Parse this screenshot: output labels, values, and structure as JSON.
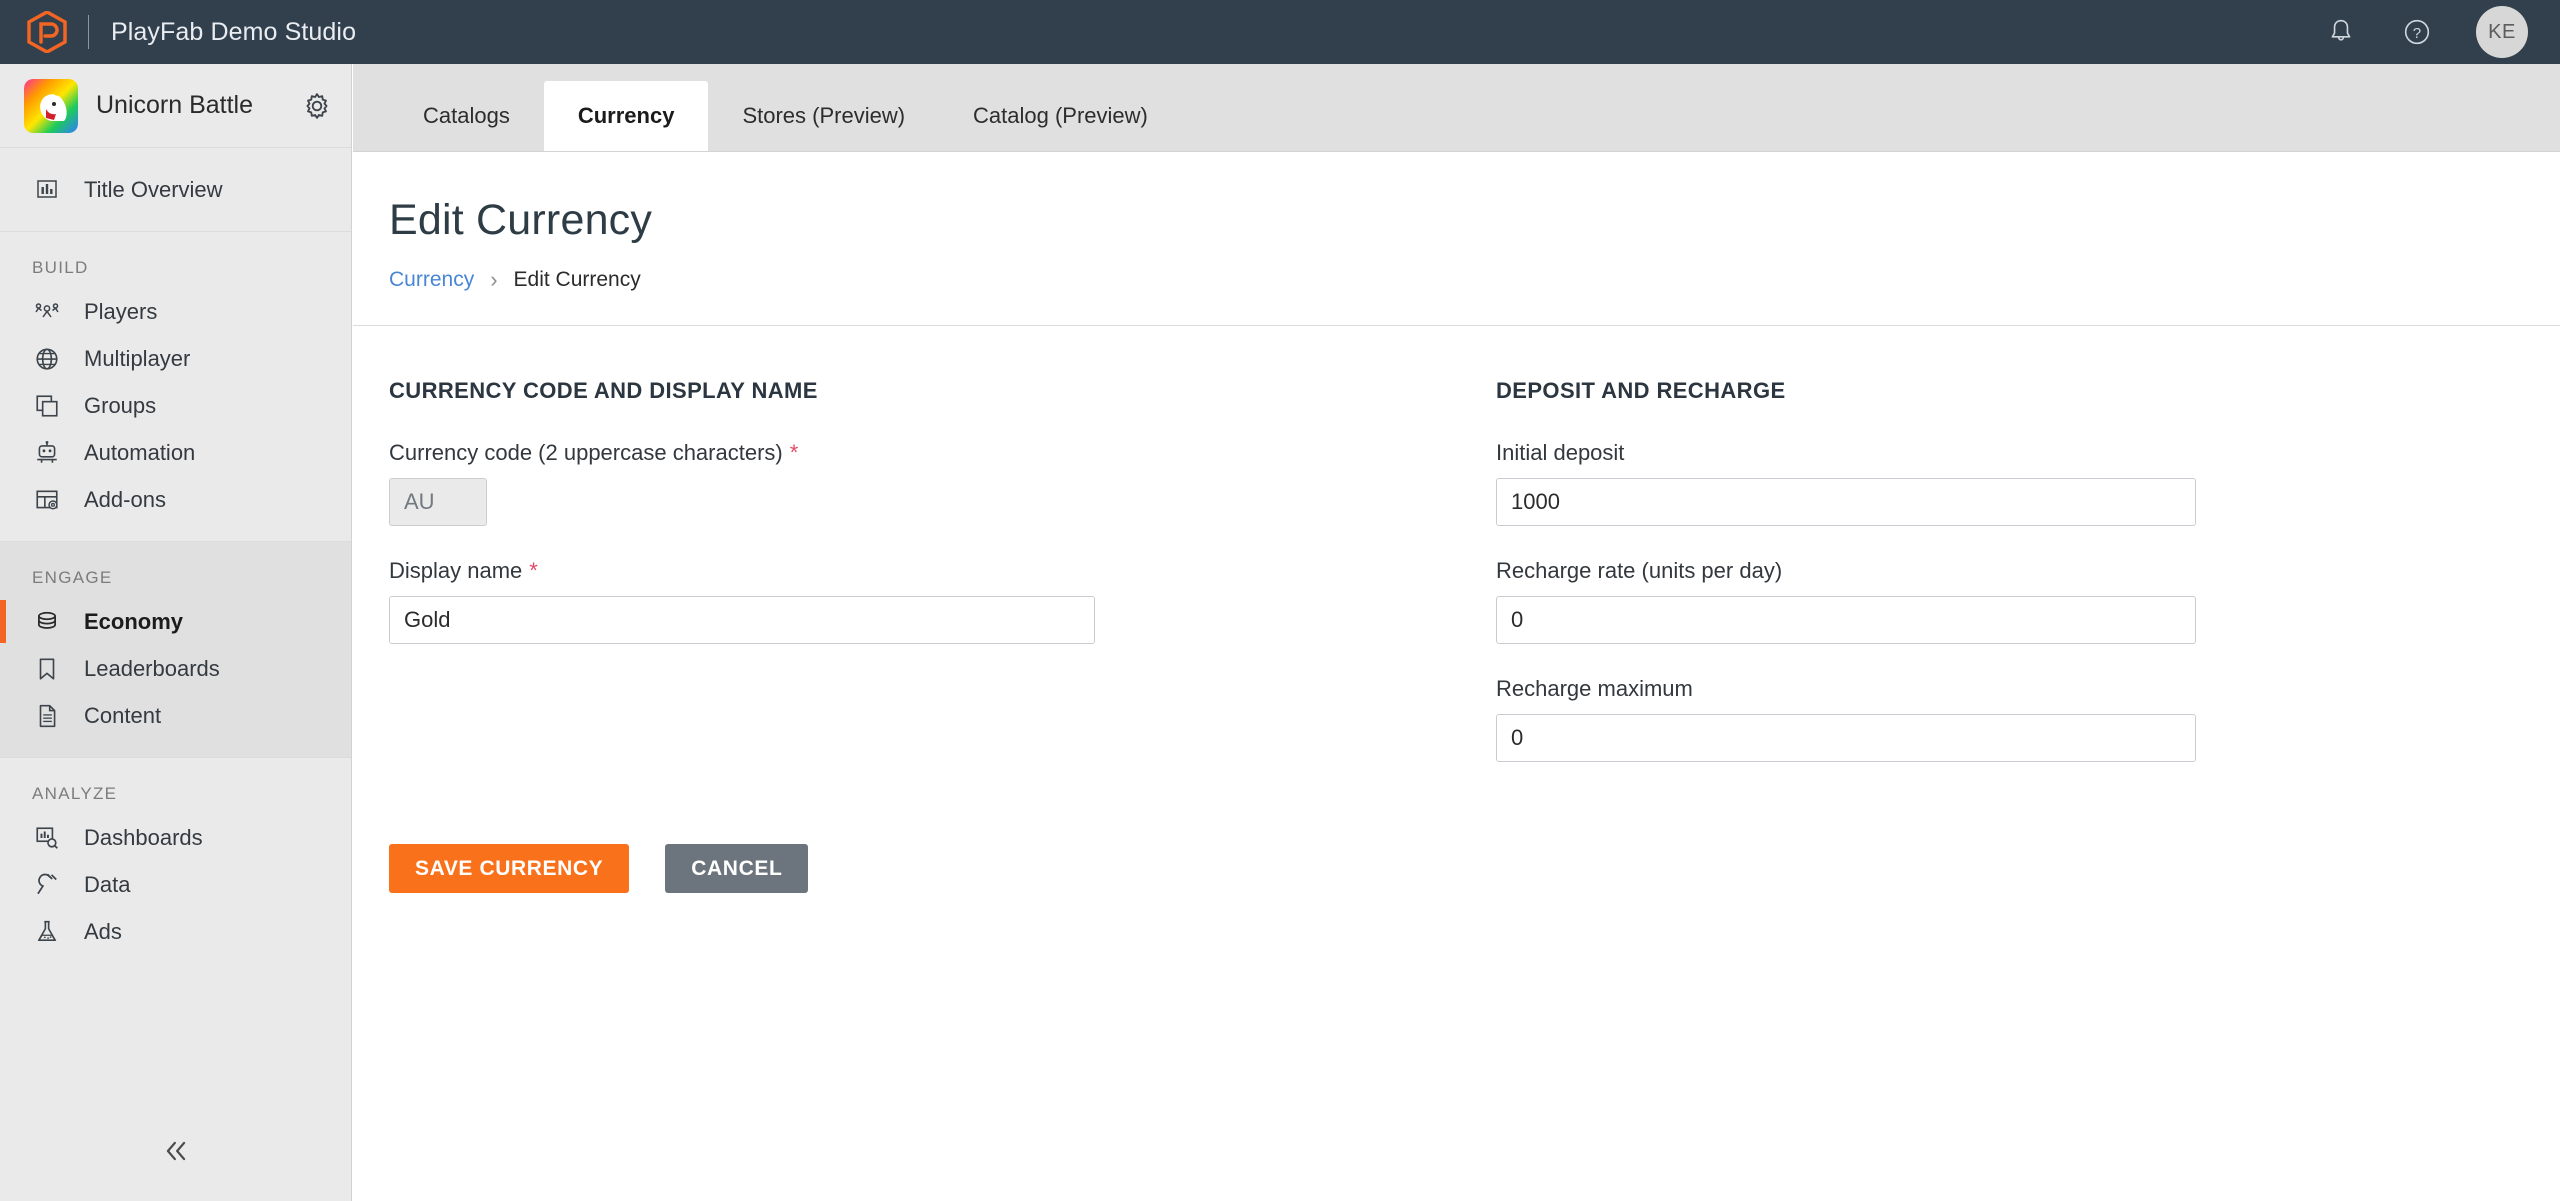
{
  "topbar": {
    "brand_title": "PlayFab Demo Studio",
    "logo_icon": "playfab-hexagon-logo",
    "notifications_icon": "bell-icon",
    "help_icon": "question-circle-icon",
    "avatar_initials": "KE",
    "colors": {
      "background": "#32404e",
      "logo": "#f26522"
    }
  },
  "sidebar": {
    "title_name": "Unicorn Battle",
    "title_thumb_icon": "unicorn-title-thumbnail",
    "settings_icon": "gear-icon",
    "collapse_icon": "double-chevron-left-icon",
    "top_items": [
      {
        "label": "Title Overview",
        "icon": "bar-chart-icon",
        "active": false
      }
    ],
    "groups": [
      {
        "heading": "BUILD",
        "items": [
          {
            "label": "Players",
            "icon": "people-icon",
            "active": false
          },
          {
            "label": "Multiplayer",
            "icon": "globe-icon",
            "active": false
          },
          {
            "label": "Groups",
            "icon": "stacked-squares-icon",
            "active": false
          },
          {
            "label": "Automation",
            "icon": "robot-icon",
            "active": false
          },
          {
            "label": "Add-ons",
            "icon": "table-gear-icon",
            "active": false
          }
        ]
      },
      {
        "heading": "ENGAGE",
        "items": [
          {
            "label": "Economy",
            "icon": "coins-stack-icon",
            "active": true
          },
          {
            "label": "Leaderboards",
            "icon": "bookmark-icon",
            "active": false
          },
          {
            "label": "Content",
            "icon": "document-icon",
            "active": false
          }
        ]
      },
      {
        "heading": "ANALYZE",
        "items": [
          {
            "label": "Dashboards",
            "icon": "chart-magnifier-icon",
            "active": false
          },
          {
            "label": "Data",
            "icon": "plug-icon",
            "active": false
          },
          {
            "label": "Ads",
            "icon": "flask-icon",
            "active": false
          }
        ]
      }
    ],
    "active_accent_color": "#f26522"
  },
  "main": {
    "tabs": [
      {
        "label": "Catalogs",
        "active": false
      },
      {
        "label": "Currency",
        "active": true
      },
      {
        "label": "Stores (Preview)",
        "active": false
      },
      {
        "label": "Catalog (Preview)",
        "active": false
      }
    ],
    "page_title": "Edit Currency",
    "breadcrumb": {
      "link": "Currency",
      "separator": "›",
      "current": "Edit Currency"
    },
    "left_section": {
      "heading": "CURRENCY CODE AND DISPLAY NAME",
      "fields": [
        {
          "label": "Currency code (2 uppercase characters)",
          "required_marker": "*",
          "value": "AU",
          "placeholder": "",
          "disabled": true
        },
        {
          "label": "Display name",
          "required_marker": "*",
          "value": "Gold",
          "placeholder": "",
          "disabled": false
        }
      ]
    },
    "right_section": {
      "heading": "DEPOSIT AND RECHARGE",
      "fields": [
        {
          "label": "Initial deposit",
          "value": "1000",
          "placeholder": ""
        },
        {
          "label": "Recharge rate (units per day)",
          "value": "0",
          "placeholder": ""
        },
        {
          "label": "Recharge maximum",
          "value": "0",
          "placeholder": ""
        }
      ]
    },
    "buttons": {
      "save_label": "SAVE CURRENCY",
      "cancel_label": "CANCEL",
      "save_color": "#f9721b",
      "cancel_color": "#6c757d"
    }
  }
}
